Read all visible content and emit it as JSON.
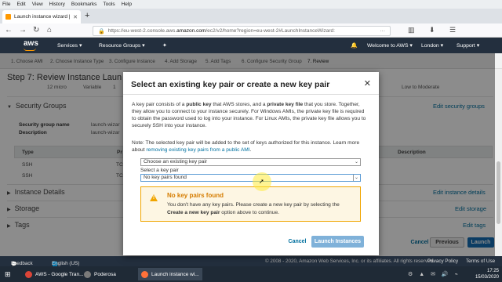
{
  "browser": {
    "menu": [
      "File",
      "Edit",
      "View",
      "History",
      "Bookmarks",
      "Tools",
      "Help"
    ],
    "tab_title": "Launch instance wizard | EC2 M",
    "url_prefix": "https://eu-west-2.console.aws.",
    "url_host": "amazon.com",
    "url_rest": "/ec2/v2/home?region=eu-west-2#LaunchInstanceWizard:",
    "url_dots": "···"
  },
  "aws_header": {
    "logo": "aws",
    "services": "Services ▾",
    "resource_groups": "Resource Groups ▾",
    "pin": "✦",
    "bell": "🔔",
    "account": "Welcome to AWS ▾",
    "region": "London ▾",
    "support": "Support ▾"
  },
  "steps": [
    "1. Choose AMI",
    "2. Choose Instance Type",
    "3. Configure Instance",
    "4. Add Storage",
    "5. Add Tags",
    "6. Configure Security Group",
    "7. Review"
  ],
  "page": {
    "title": "Step 7: Review Instance Laun",
    "top_cells": [
      "12 micro",
      "Variable",
      "1",
      "Low to Moderate"
    ],
    "security_groups": "Security Groups",
    "edit_security_groups": "Edit security groups",
    "sg_name_label": "Security group name",
    "sg_name_value": "launch-wizar",
    "sg_desc_label": "Description",
    "sg_desc_value": "launch-wizar",
    "col_type": "Type",
    "col_protocol": "Pr",
    "col_description": "Description",
    "rows": [
      {
        "type": "SSH",
        "protocol": "TC"
      },
      {
        "type": "SSH",
        "protocol": "TC"
      }
    ],
    "instance_details": "Instance Details",
    "edit_instance_details": "Edit instance details",
    "storage": "Storage",
    "edit_storage": "Edit storage",
    "tags": "Tags",
    "edit_tags": "Edit tags",
    "cancel": "Cancel",
    "previous": "Previous",
    "launch": "Launch"
  },
  "modal": {
    "title": "Select an existing key pair or create a new key pair",
    "close": "✕",
    "p1_a": "A key pair consists of a ",
    "p1_b": "public key",
    "p1_c": " that AWS stores, and a ",
    "p1_d": "private key file",
    "p1_e": " that you store. Together, they allow you to connect to your instance securely. For Windows AMIs, the private key file is required to obtain the password used to log into your instance. For Linux AMIs, the private key file allows you to securely SSH into your instance.",
    "note": "Note: The selected key pair will be added to the set of keys authorized for this instance. Learn more about ",
    "note_link": "removing existing key pairs from a public AMI",
    "note_end": ".",
    "select1": "Choose an existing key pair",
    "select_label": "Select a key pair",
    "select2": "No key pairs found",
    "warn_title": "No key pairs found",
    "warn_a": "You don't have any key pairs. Please create a new key pair by selecting the ",
    "warn_b": "Create a new key pair",
    "warn_c": " option above to continue.",
    "cancel": "Cancel",
    "launch": "Launch Instances"
  },
  "footer": {
    "feedback": "Feedback",
    "language": "English (US)",
    "copyright": "© 2008 - 2020, Amazon Web Services, Inc. or its affiliates. All rights reserved.",
    "privacy": "Privacy Policy",
    "terms": "Terms of Use"
  },
  "taskbar": {
    "app1": "AWS - Google Tran...",
    "app2": "Poderosa",
    "app3": "Launch instance wi...",
    "time": "17:25",
    "date": "15/03/2020"
  },
  "colors": {
    "aws_dark": "#232f3e",
    "aws_orange": "#ff9900",
    "link": "#00709f",
    "primary": "#146eb4",
    "warning": "#f0a500"
  }
}
